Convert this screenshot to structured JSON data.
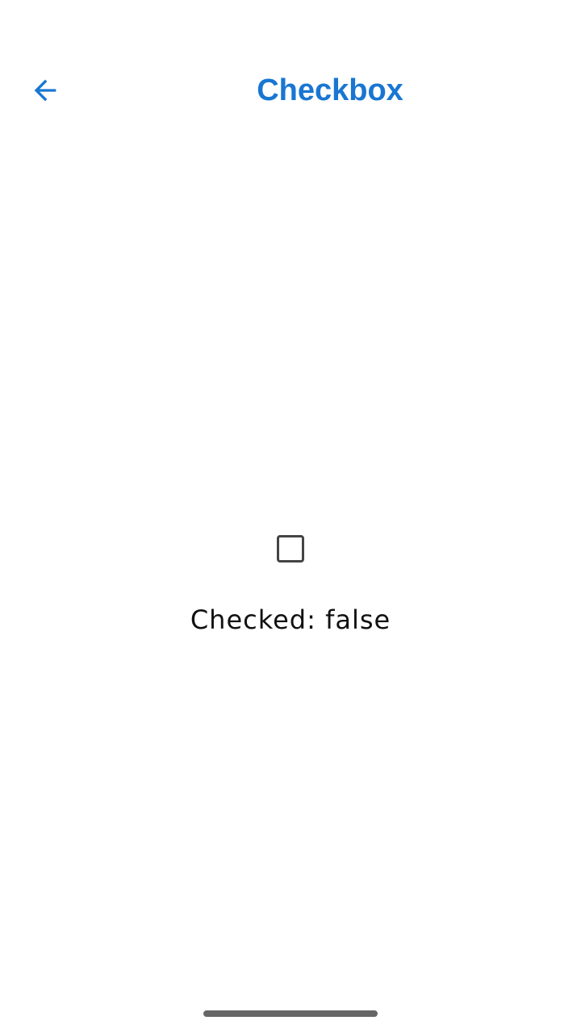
{
  "colors": {
    "accent": "#1976D2",
    "checkbox_border": "#444444",
    "text": "#111111",
    "home_indicator": "#666666"
  },
  "header": {
    "back_icon": "arrow-left-icon",
    "title": "Checkbox"
  },
  "checkbox": {
    "checked": false,
    "status_text": "Checked: false"
  }
}
